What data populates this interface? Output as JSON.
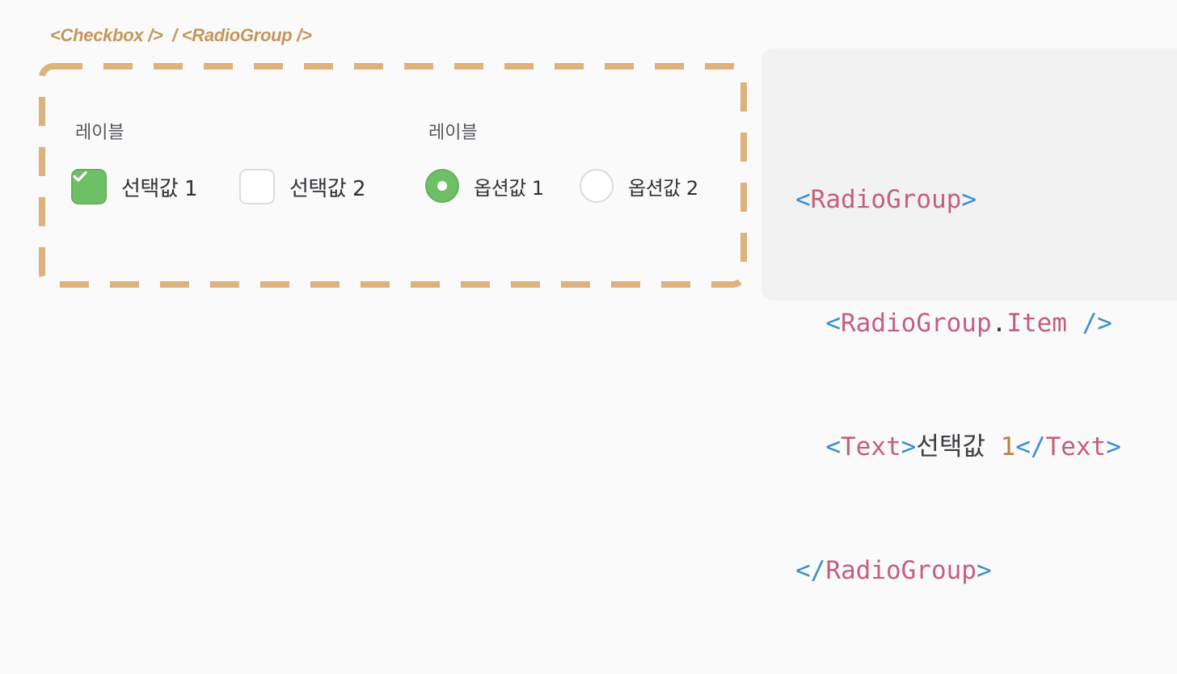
{
  "caption": "<Checkbox />  / <RadioGroup />",
  "checkbox_group": {
    "label": "레이블",
    "options": [
      {
        "label": "선택값 1",
        "checked": true
      },
      {
        "label": "선택값 2",
        "checked": false
      }
    ]
  },
  "radio_group": {
    "label": "레이블",
    "options": [
      {
        "label": "옵션값 1",
        "selected": true
      },
      {
        "label": "옵션값 2",
        "selected": false
      }
    ]
  },
  "code": {
    "line1_open": "<",
    "line1_tag": "RadioGroup",
    "line1_close": ">",
    "line2_open": "<",
    "line2_tag": "RadioGroup",
    "line2_dot": ".",
    "line2_member": "Item",
    "line2_close": " />",
    "line3_open": "<",
    "line3_tag": "Text",
    "line3_mid": ">",
    "line3_text": "선택값 ",
    "line3_num": "1",
    "line3_endopen": "</",
    "line3_endtag": "Text",
    "line3_close": ">",
    "line4_open": "</",
    "line4_tag": "RadioGroup",
    "line4_close": ">"
  },
  "colors": {
    "accent_green": "#6fbf66",
    "frame_dash": "#ddb27c",
    "caption": "#c4975a",
    "code_punct": "#3b8fd0",
    "code_tag": "#c45f7c"
  }
}
